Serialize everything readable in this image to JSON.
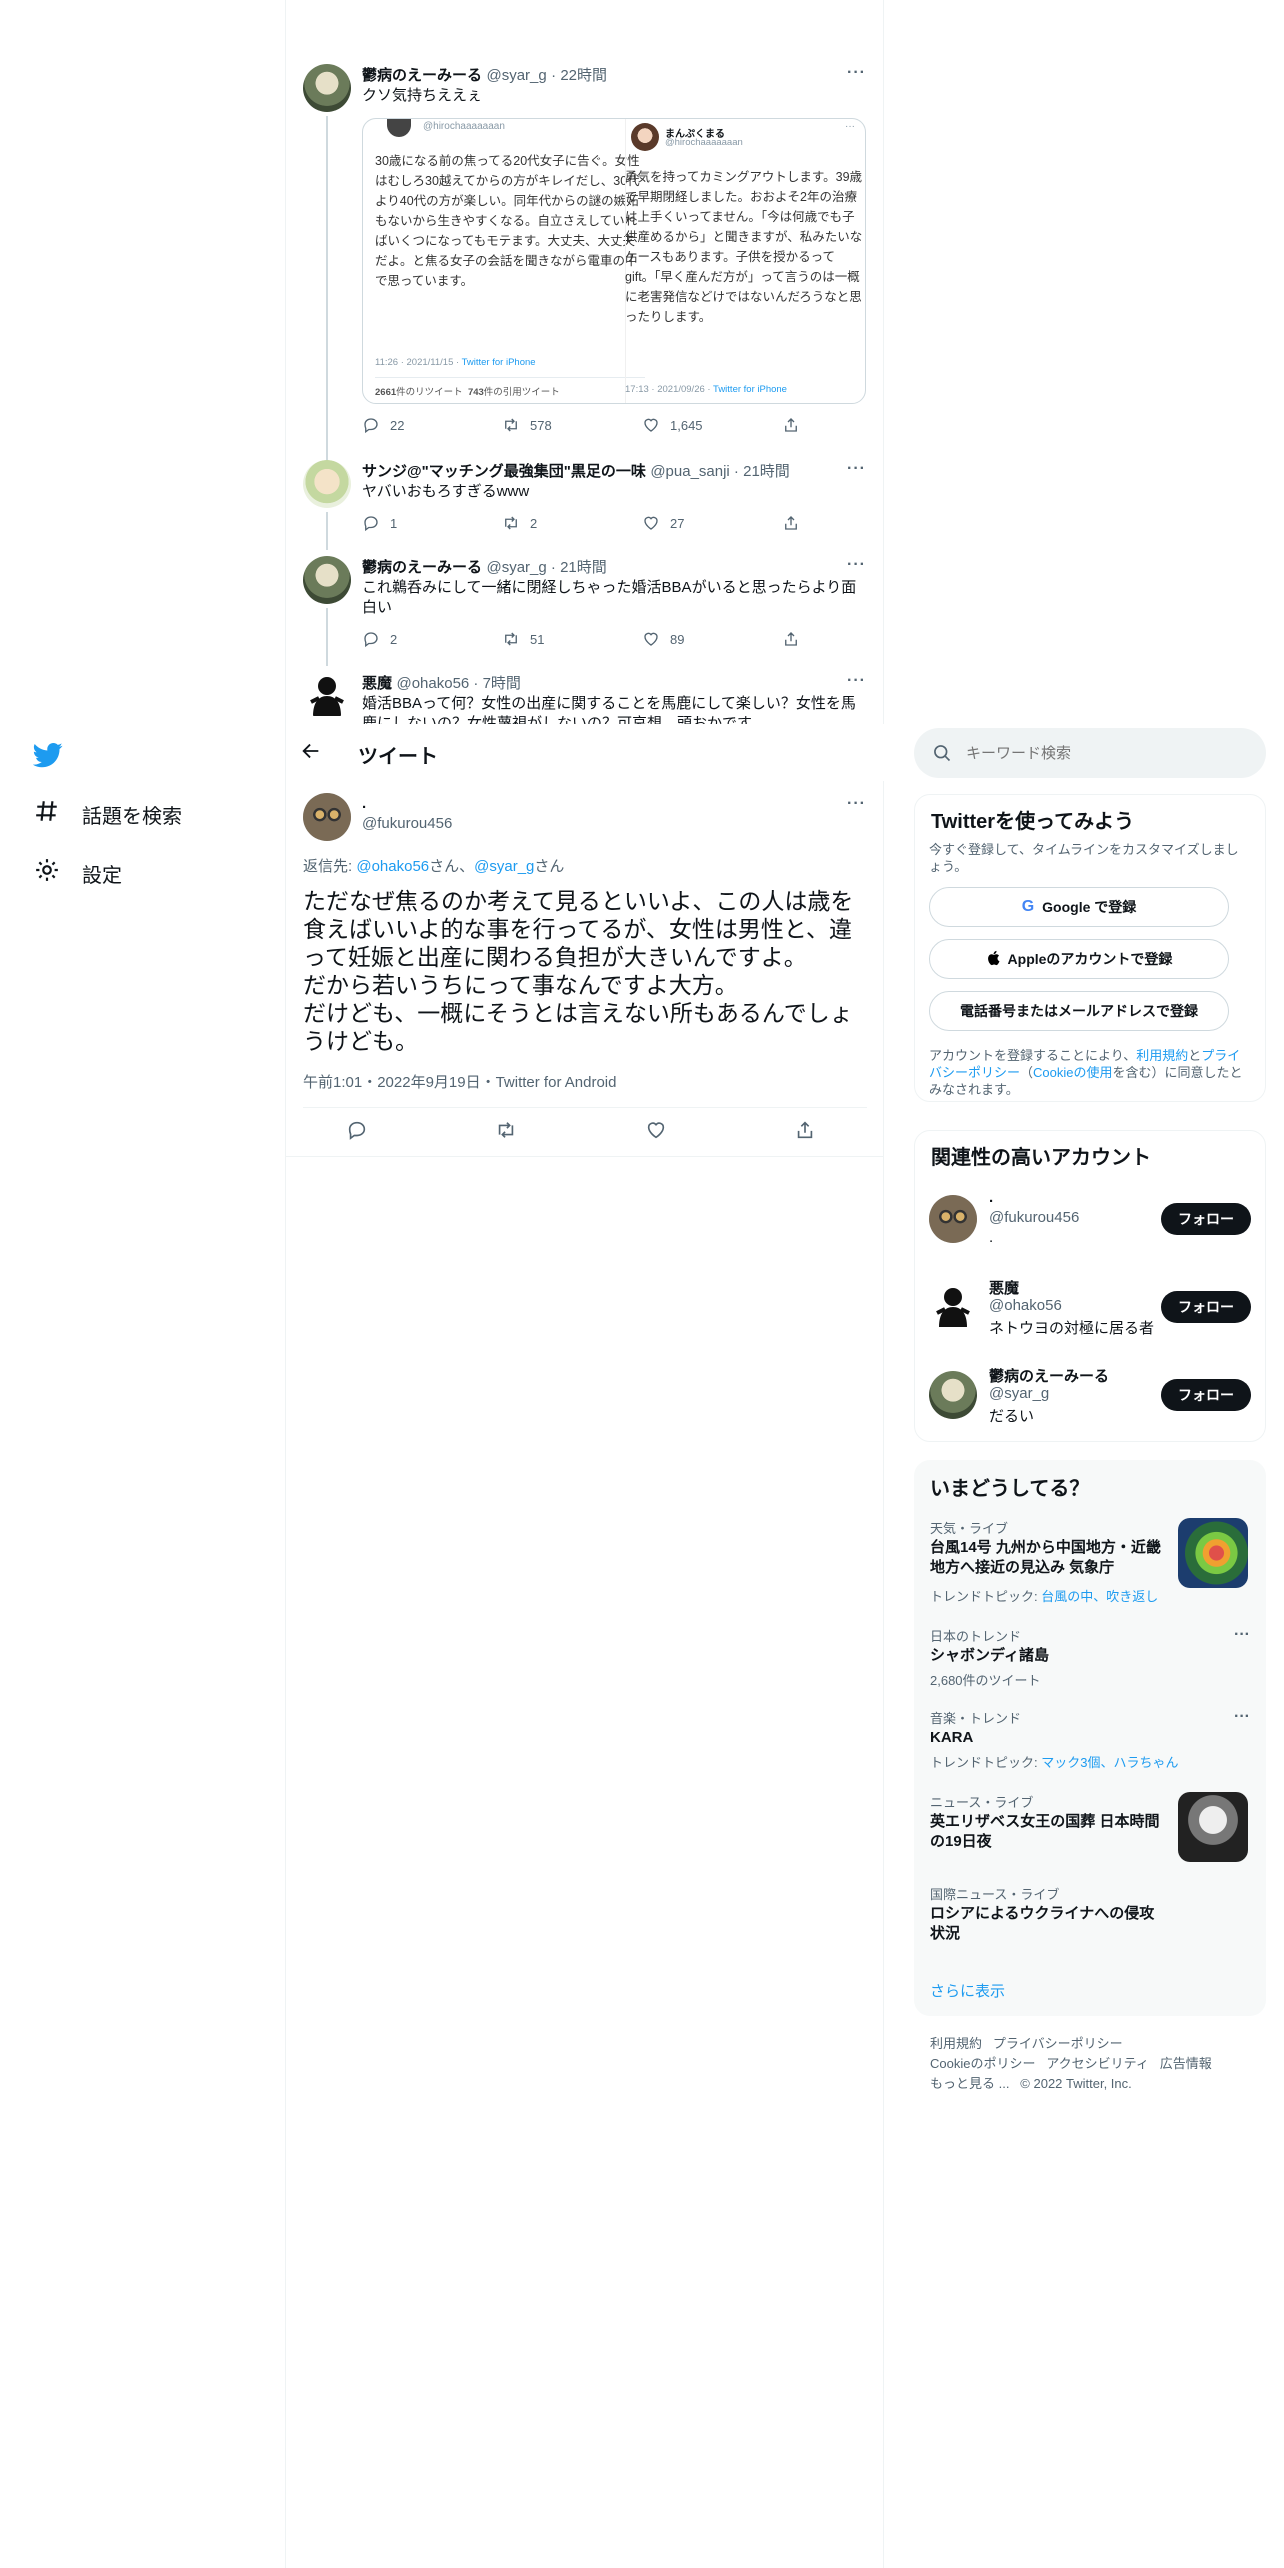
{
  "nav": {
    "items": [
      {
        "label": "話題を検索",
        "icon": "hashtag-icon"
      },
      {
        "label": "設定",
        "icon": "gear-icon"
      }
    ]
  },
  "thread": [
    {
      "name": "鬱病のえーみーる",
      "handle": "@syar_g",
      "time": "22時間",
      "text": "クソ気持ちええぇ",
      "embed": {
        "left_handle": "@hirochaaaaaaan",
        "left_text": "30歳になる前の焦ってる20代女子に告ぐ。女性はむしろ30越えてからの方がキレイだし、30代より40代の方が楽しい。同年代からの謎の嫉妬もないから生きやすくなる。自立さえしていればいくつになってもモテます。大丈夫、大丈夫だよ。と焦る女子の会話を聞きながら電車の中で思っています。",
        "left_time": "11:26 · 2021/11/15 · ",
        "left_client": "Twitter for iPhone",
        "left_rt": "2661",
        "left_rt_label": "件のリツイート",
        "left_qt": "743",
        "left_qt_label": "件の引用ツイート",
        "right_name": "まんぷくまる",
        "right_handle": "@hirochaaaaaaan",
        "right_text": "勇気を持ってカミングアウトします。39歳で早期閉経しました。おおよそ2年の治療は上手くいってません。「今は何歳でも子供産めるから」と聞きますが、私みたいなケースもあります。子供を授かるってgift。「早く産んだ方が」って言うのは一概に老害発信などけではないんだろうなと思ったりします。",
        "right_time": "17:13 · 2021/09/26 · ",
        "right_client": "Twitter for iPhone"
      },
      "replies": "22",
      "retweets": "578",
      "likes": "1,645"
    },
    {
      "name": "サンジ@\"マッチング最強集団\"黒足の一味",
      "handle": "@pua_sanji",
      "time": "21時間",
      "text": "ヤバいおもろすぎるwww",
      "replies": "1",
      "retweets": "2",
      "likes": "27"
    },
    {
      "name": "鬱病のえーみーる",
      "handle": "@syar_g",
      "time": "21時間",
      "text": "これ鵜呑みにして一緒に閉経しちゃった婚活BBAがいると思ったらより面白い",
      "replies": "2",
      "retweets": "51",
      "likes": "89"
    },
    {
      "name": "悪魔",
      "handle": "@ohako56",
      "time": "7時間",
      "text": "婚活BBAって何？女性の出産に関することを馬鹿にして楽しい？女性を馬鹿にしないの？女性蔑視がしないの？可哀想、頭おかです"
    }
  ],
  "header": {
    "title": "ツイート"
  },
  "main_tweet": {
    "name": ".",
    "handle": "@fukurou456",
    "reply_prefix": "返信先: ",
    "reply_to_1": "@ohako56",
    "reply_san_1": "さん、",
    "reply_to_2": "@syar_g",
    "reply_san_2": "さん",
    "text": "ただなぜ焦るのか考えて見るといいよ、この人は歳を食えばいいよ的な事を行ってるが、女性は男性と、違って妊娠と出産に関わる負担が大きいんですよ。\nだから若いうちにって事なんですよ大方。\nだけども、一概にそうとは言えない所もあるんでしょうけども。",
    "meta": "午前1:01・2022年9月19日・Twitter for Android"
  },
  "search": {
    "placeholder": "キーワード検索"
  },
  "signup": {
    "title": "Twitterを使ってみよう",
    "subtitle": "今すぐ登録して、タイムラインをカスタマイズしましょう。",
    "google": "Google で登録",
    "apple": "Appleのアカウントで登録",
    "phone": "電話番号またはメールアドレスで登録",
    "legal_1": "アカウントを登録することにより、",
    "legal_terms": "利用規約",
    "legal_and": "と",
    "legal_privacy": "プライバシーポリシー",
    "legal_2": "（",
    "legal_cookie": "Cookieの使用",
    "legal_3": "を含む）に同意したとみなされます。"
  },
  "related": {
    "title": "関連性の高いアカウント",
    "follow_label": "フォロー",
    "accounts": [
      {
        "name": ".",
        "handle": "@fukurou456",
        "bio": "."
      },
      {
        "name": "悪魔",
        "handle": "@ohako56",
        "bio": "ネトウヨの対極に居る者"
      },
      {
        "name": "鬱病のえーみーる",
        "handle": "@syar_g",
        "bio": "だるい"
      }
    ]
  },
  "trends": {
    "title": "いまどうしてる？",
    "items": [
      {
        "category": "天気・ライブ",
        "title": "台風14号 九州から中国地方・近畿地方へ接近の見込み 気象庁",
        "sub_prefix": "トレンドトピック: ",
        "sub_links": "台風の中、吹き返し"
      },
      {
        "category": "日本のトレンド",
        "title": "シャボンディ諸島",
        "sub_prefix": "2,680件のツイート",
        "sub_links": ""
      },
      {
        "category": "音楽・トレンド",
        "title": "KARA",
        "sub_prefix": "トレンドトピック: ",
        "sub_links": "マック3個、ハラちゃん"
      },
      {
        "category": "ニュース・ライブ",
        "title": "英エリザベス女王の国葬 日本時間の19日夜",
        "sub_prefix": "",
        "sub_links": ""
      },
      {
        "category": "国際ニュース・ライブ",
        "title": "ロシアによるウクライナへの侵攻状況",
        "sub_prefix": "",
        "sub_links": ""
      }
    ],
    "show_more": "さらに表示"
  },
  "footer": {
    "line1_a": "利用規約",
    "line1_b": "プライバシーポリシー",
    "line2_a": "Cookieのポリシー",
    "line2_b": "アクセシビリティ",
    "line2_c": "広告情報",
    "line3_a": "もっと見る ...",
    "line3_b": "© 2022 Twitter, Inc."
  },
  "colors": {
    "accent": "#1d9bf0",
    "text": "#0f1419",
    "muted": "#536471"
  }
}
